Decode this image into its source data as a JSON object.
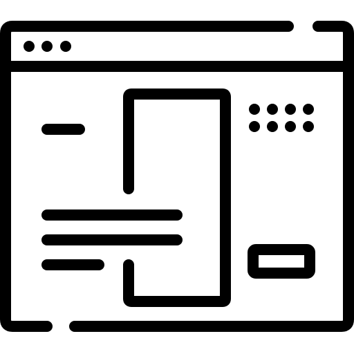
{
  "icon": {
    "name": "website-layout-icon",
    "stroke_color": "#000000",
    "background_color": "#ffffff"
  }
}
